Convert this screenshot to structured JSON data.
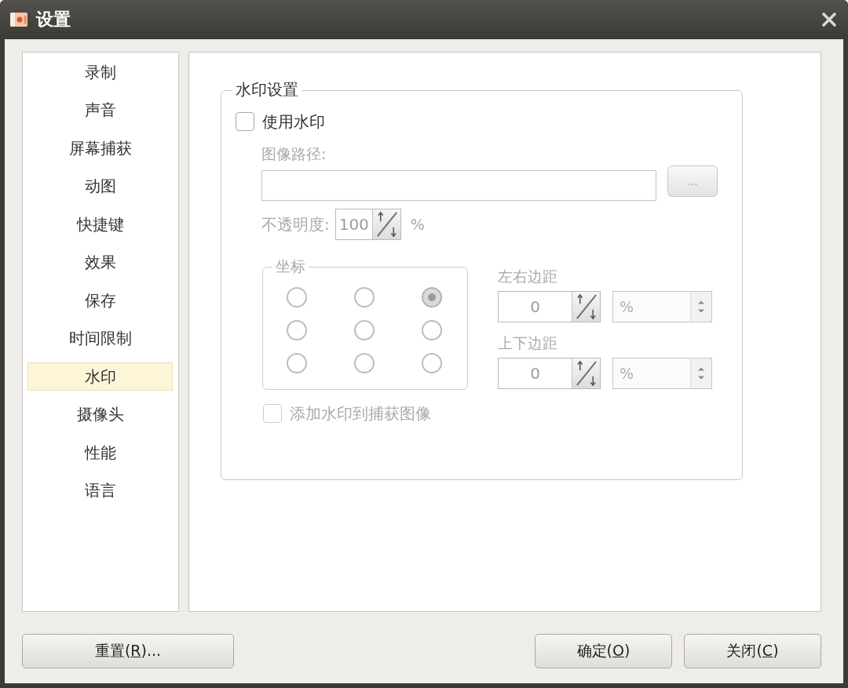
{
  "window": {
    "title": "设置"
  },
  "sidebar": {
    "items": [
      {
        "label": "录制",
        "selected": false
      },
      {
        "label": "声音",
        "selected": false
      },
      {
        "label": "屏幕捕获",
        "selected": false
      },
      {
        "label": "动图",
        "selected": false
      },
      {
        "label": "快捷键",
        "selected": false
      },
      {
        "label": "效果",
        "selected": false
      },
      {
        "label": "保存",
        "selected": false
      },
      {
        "label": "时间限制",
        "selected": false
      },
      {
        "label": "水印",
        "selected": true
      },
      {
        "label": "摄像头",
        "selected": false
      },
      {
        "label": "性能",
        "selected": false
      },
      {
        "label": "语言",
        "selected": false
      }
    ]
  },
  "watermark_settings": {
    "title": "水印设置",
    "use_watermark": {
      "label": "使用水印",
      "checked": false,
      "disabled": false
    },
    "image_path": {
      "label": "图像路径:",
      "disabled": true
    },
    "browse_button": {
      "label": "...",
      "disabled": true
    },
    "opacity": {
      "label": "不透明度:",
      "value": "100",
      "unit": "%",
      "disabled": true
    },
    "position": {
      "title": "坐标",
      "disabled": true,
      "options": [
        {
          "selected": false
        },
        {
          "selected": false
        },
        {
          "selected": true
        },
        {
          "selected": false
        },
        {
          "selected": false
        },
        {
          "selected": false
        },
        {
          "selected": false
        },
        {
          "selected": false
        },
        {
          "selected": false
        }
      ]
    },
    "horizontal_margin": {
      "label": "左右边距",
      "value": "0",
      "unit": "%",
      "disabled": true
    },
    "vertical_margin": {
      "label": "上下边距",
      "value": "0",
      "unit": "%",
      "disabled": true
    },
    "add_to_captured_images": {
      "label": "添加水印到捕获图像",
      "checked": false,
      "disabled": true
    }
  },
  "footer": {
    "left_buttons": [
      {
        "label_start": "重置(",
        "access_key": "R",
        "label_end": ")..."
      }
    ],
    "right_buttons": [
      {
        "label_start": "确定(",
        "access_key": "O",
        "label_end": ")"
      },
      {
        "label_start": "关闭(",
        "access_key": "C",
        "label_end": ")"
      }
    ]
  }
}
